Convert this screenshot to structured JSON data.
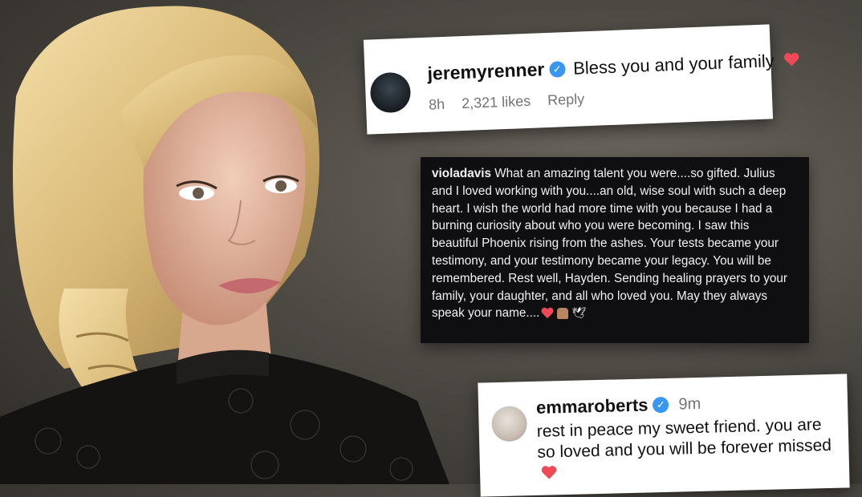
{
  "comments": [
    {
      "username": "jeremyrenner",
      "text": "Bless you and your family",
      "time": "8h",
      "likes": "2,321 likes",
      "reply": "Reply",
      "verified": true
    },
    {
      "username": "violadavis",
      "text": " What an amazing talent you were....so gifted. Julius and I loved working with you....an old, wise soul with such a deep heart. I wish the world had more time with you because I had a burning curiosity about who you were becoming. I saw this beautiful Phoenix rising from the ashes. Your tests became your testimony, and your testimony became your legacy. You will be remembered. Rest well, Hayden. Sending healing prayers to your family, your daughter, and all who loved you. May they always speak your name...."
    },
    {
      "username": "emmaroberts",
      "time": "9m",
      "text": "rest in peace my sweet friend. you are so loved and you will be forever missed",
      "verified": true
    }
  ],
  "colors": {
    "heart": "#ed4956",
    "verified": "#3897f0"
  }
}
